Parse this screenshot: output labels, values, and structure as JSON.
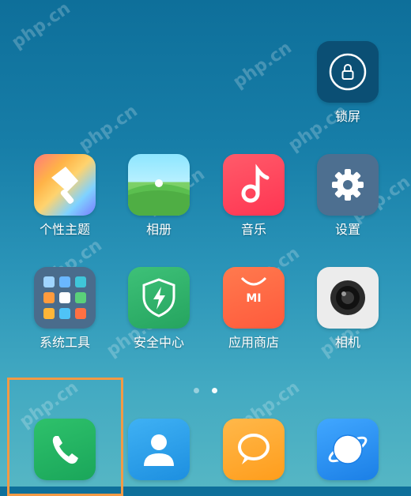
{
  "apps": {
    "lock": {
      "label": "锁屏",
      "icon": "lock-icon"
    },
    "theme": {
      "label": "个性主题",
      "icon": "paintbrush-icon"
    },
    "gallery": {
      "label": "相册",
      "icon": "landscape-icon"
    },
    "music": {
      "label": "音乐",
      "icon": "music-note-icon"
    },
    "settings": {
      "label": "设置",
      "icon": "gear-icon"
    },
    "tools": {
      "label": "系统工具",
      "icon": "folder-grid-icon"
    },
    "security": {
      "label": "安全中心",
      "icon": "shield-bolt-icon"
    },
    "store": {
      "label": "应用商店",
      "icon": "shopping-bag-icon",
      "badge": "MI"
    },
    "camera": {
      "label": "相机",
      "icon": "camera-lens-icon"
    }
  },
  "dock": {
    "phone": {
      "icon": "phone-icon"
    },
    "contacts": {
      "icon": "person-icon"
    },
    "messages": {
      "icon": "chat-bubble-icon"
    },
    "browser": {
      "icon": "globe-icon"
    }
  },
  "pager": {
    "current": 1,
    "total": 2
  },
  "watermark_text": "php.cn",
  "colors": {
    "highlight": "#f29a45",
    "phone": "#1aa65a",
    "music": "#ff3552",
    "store": "#ff5a3c"
  }
}
